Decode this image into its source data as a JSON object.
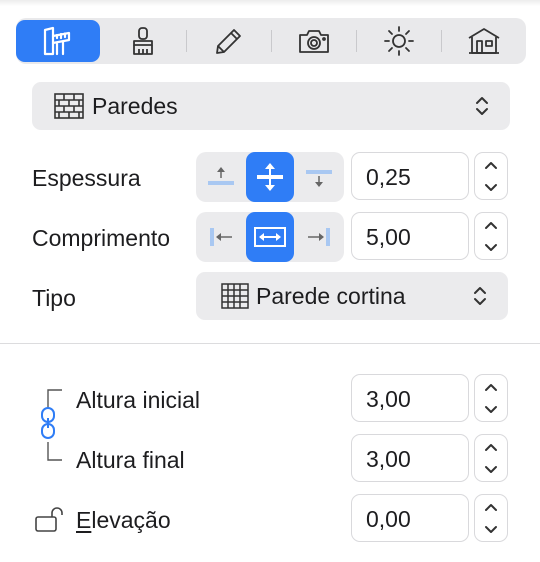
{
  "toolbar": {
    "tabs": [
      {
        "name": "measure-tool",
        "active": true
      },
      {
        "name": "materials"
      },
      {
        "name": "edit"
      },
      {
        "name": "camera"
      },
      {
        "name": "light"
      },
      {
        "name": "building"
      }
    ]
  },
  "category": {
    "label": "Paredes"
  },
  "espessura": {
    "label": "Espessura",
    "value": "0,25",
    "selected_segment": 1
  },
  "comprimento": {
    "label": "Comprimento",
    "value": "5,00",
    "selected_segment": 1
  },
  "tipo": {
    "label": "Tipo",
    "value": "Parede cortina"
  },
  "altura_inicial": {
    "label": "Altura inicial",
    "value": "3,00"
  },
  "altura_final": {
    "label": "Altura final",
    "value": "3,00"
  },
  "elevacao": {
    "label_first": "E",
    "label_rest": "levação",
    "value": "0,00"
  },
  "colors": {
    "accent": "#2f7df6",
    "control_bg": "#ebebed"
  }
}
